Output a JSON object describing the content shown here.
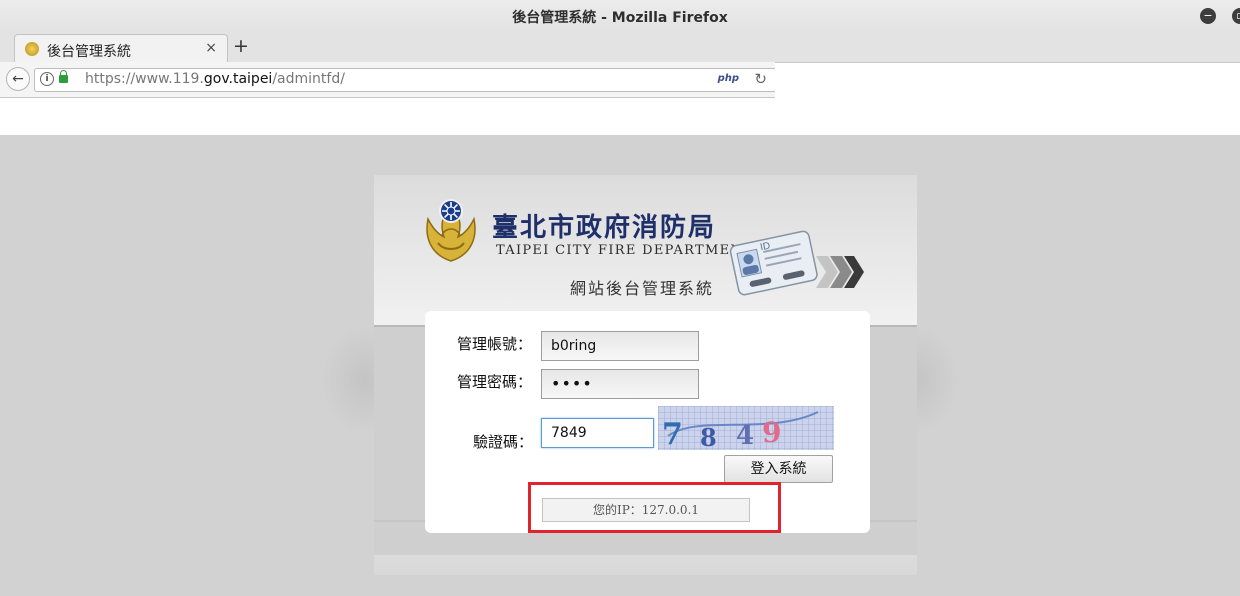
{
  "window": {
    "title": "後台管理系統 - Mozilla Firefox"
  },
  "tab": {
    "label": "後台管理系統",
    "close_glyph": "×",
    "new_tab_glyph": "+"
  },
  "nav": {
    "back_glyph": "←",
    "info_glyph": "i",
    "url_prefix": "https://www.119.",
    "url_domain": "gov.taipei",
    "url_path": "/admintfd/",
    "php_badge": "php",
    "reload_glyph": "↻"
  },
  "header": {
    "org_zh": "臺北市政府消防局",
    "org_en": "TAIPEI CITY FIRE DEPARTMENT",
    "system_name": "網站後台管理系統",
    "id_card_label": "ID"
  },
  "form": {
    "account_label": "管理帳號：",
    "account_value": "b0ring",
    "password_label": "管理密碼：",
    "password_value": "••••",
    "captcha_label": "驗證碼：",
    "captcha_value": "7849",
    "captcha_image_chars": [
      "7",
      "8",
      "4",
      "9"
    ],
    "login_button": "登入系統",
    "ip_text": "您的IP：127.0.0.1"
  },
  "colors": {
    "highlight_border": "#e1232c",
    "org_title": "#1f2f6a"
  },
  "icons": [
    "close-window-icon",
    "restore-window-icon",
    "back-arrow-icon",
    "info-icon",
    "lock-icon",
    "reload-icon",
    "fire-department-emblem-icon",
    "id-card-icon"
  ]
}
